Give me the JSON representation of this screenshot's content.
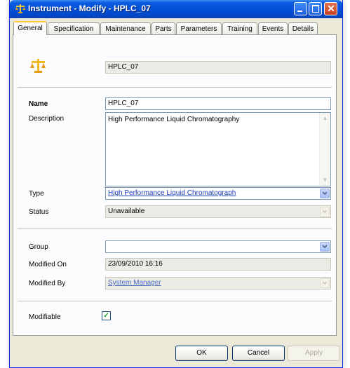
{
  "window": {
    "title": "Instrument - Modify - HPLC_07"
  },
  "tabs": [
    "General",
    "Specification",
    "Maintenance",
    "Parts",
    "Parameters",
    "Training",
    "Events",
    "Details"
  ],
  "active_tab": "General",
  "header": {
    "id_value": "HPLC_07"
  },
  "form": {
    "name_label": "Name",
    "name_value": "HPLC_07",
    "description_label": "Description",
    "description_value": "High Performance Liquid Chromatography",
    "type_label": "Type",
    "type_value": "High Performance Liquid Chromatograph",
    "status_label": "Status",
    "status_value": "Unavailable",
    "group_label": "Group",
    "group_value": "",
    "modified_on_label": "Modified On",
    "modified_on_value": "23/09/2010 16:16",
    "modified_by_label": "Modified By",
    "modified_by_value": "System Manager",
    "modifiable_label": "Modifiable",
    "modifiable_checked": true
  },
  "buttons": {
    "ok": "OK",
    "cancel": "Cancel",
    "apply": "Apply"
  },
  "icons": {
    "title": "scales-icon",
    "header": "scales-icon"
  },
  "colors": {
    "titlebar": "#0451d8",
    "link": "#1a3fb6",
    "active_tab_accent": "#ffc83c"
  }
}
